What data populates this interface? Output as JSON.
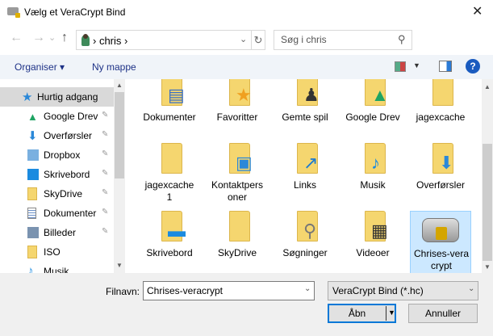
{
  "window": {
    "title": "Vælg et VeraCrypt Bind",
    "close": "✕"
  },
  "nav": {
    "back": "←",
    "forward": "→",
    "recent": "⌄",
    "up": "↑",
    "breadcrumb": "›  chris  ›",
    "address_dropdown": "⌄",
    "refresh": "↻",
    "search_placeholder": "Søg i chris",
    "search_icon": "⚲"
  },
  "toolbar": {
    "organize": "Organiser ▾",
    "new_folder": "Ny mappe",
    "view_dropdown": "▼",
    "help": "?"
  },
  "sidebar": {
    "items": [
      {
        "label": "Hurtig adgang",
        "icon": "star-icon",
        "color": "#2b88d8",
        "pinned": false
      },
      {
        "label": "Google Drev",
        "icon": "google-drive-icon",
        "color": "#1fa463",
        "pinned": true
      },
      {
        "label": "Overførsler",
        "icon": "download-icon",
        "color": "#2b88d8",
        "pinned": true
      },
      {
        "label": "Dropbox",
        "icon": "dropbox-icon",
        "color": "#7ab0e0",
        "pinned": true
      },
      {
        "label": "Skrivebord",
        "icon": "desktop-icon",
        "color": "#1b8be0",
        "pinned": true
      },
      {
        "label": "SkyDrive",
        "icon": "folder-icon",
        "color": "#f5d66f",
        "pinned": true
      },
      {
        "label": "Dokumenter",
        "icon": "document-icon",
        "color": "#888888",
        "pinned": true
      },
      {
        "label": "Billeder",
        "icon": "pictures-icon",
        "color": "#7a93b0",
        "pinned": true
      },
      {
        "label": "ISO",
        "icon": "folder-icon",
        "color": "#f5d66f",
        "pinned": false
      },
      {
        "label": "Musik",
        "icon": "music-icon",
        "color": "#1b8be0",
        "pinned": false
      }
    ],
    "pin_glyph": "📌"
  },
  "files": [
    {
      "name": "Dokumenter",
      "overlay": "document-icon",
      "glyph": "▤",
      "color": "#3a6fc4"
    },
    {
      "name": "Favoritter",
      "overlay": "star-icon",
      "glyph": "★",
      "color": "#f0a020"
    },
    {
      "name": "Gemte spil",
      "overlay": "chess-pawn-icon",
      "glyph": "♟",
      "color": "#333333"
    },
    {
      "name": "Google Drev",
      "overlay": "google-drive-icon",
      "glyph": "▲",
      "color": "#1fa463"
    },
    {
      "name": "jagexcache",
      "overlay": "folder-open-icon",
      "glyph": "",
      "color": "#f5d66f"
    },
    {
      "name": "jagexcache 1",
      "overlay": "folder-open-icon",
      "glyph": "",
      "color": "#f5d66f"
    },
    {
      "name": "Kontaktpersoner",
      "overlay": "contact-card-icon",
      "glyph": "▣",
      "color": "#2b88d8"
    },
    {
      "name": "Links",
      "overlay": "link-arrow-icon",
      "glyph": "↗",
      "color": "#1b7ad0"
    },
    {
      "name": "Musik",
      "overlay": "music-note-icon",
      "glyph": "♪",
      "color": "#1b8be0"
    },
    {
      "name": "Overførsler",
      "overlay": "download-icon",
      "glyph": "⬇",
      "color": "#2b88d8"
    },
    {
      "name": "Skrivebord",
      "overlay": "desktop-icon",
      "glyph": "▬",
      "color": "#1b8be0"
    },
    {
      "name": "SkyDrive",
      "overlay": "folder-icon",
      "glyph": "",
      "color": "#f5d66f"
    },
    {
      "name": "Søgninger",
      "overlay": "magnifier-icon",
      "glyph": "⚲",
      "color": "#777777"
    },
    {
      "name": "Videoer",
      "overlay": "film-icon",
      "glyph": "▦",
      "color": "#333333"
    },
    {
      "name": "Chrises-veracrypt",
      "overlay": "encrypted-drive-icon",
      "glyph": "🔒",
      "color": "#d4a500",
      "selected": true
    }
  ],
  "footer": {
    "filename_label": "Filnavn:",
    "filename_value": "Chrises-veracrypt",
    "filter": "VeraCrypt Bind (*.hc)",
    "open": "Åbn",
    "cancel": "Annuller",
    "dropdown": "⌄",
    "split_arrow": "▼"
  }
}
